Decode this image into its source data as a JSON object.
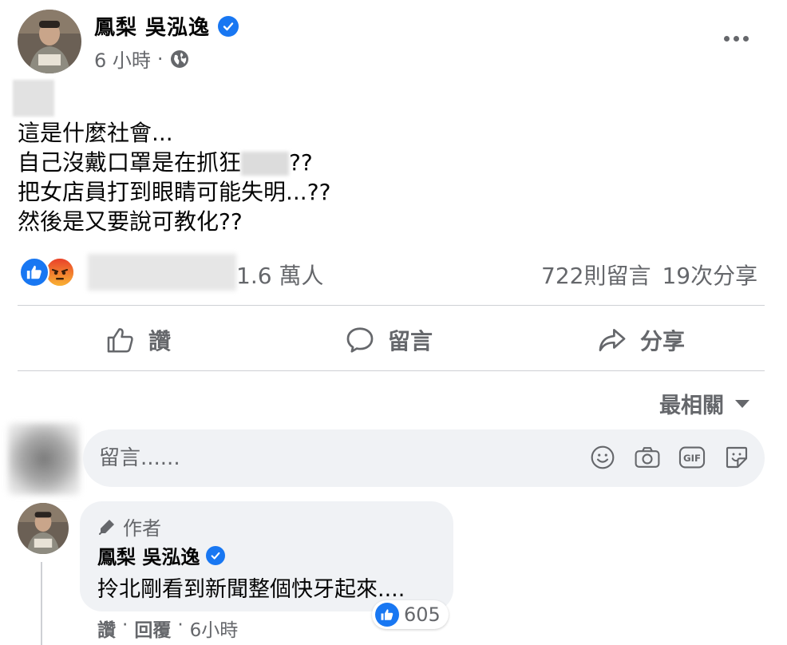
{
  "post": {
    "author": "鳳梨 吳泓逸",
    "time": "6 小時",
    "separator": "·",
    "lines": [
      {
        "text": "這是什麼社會..."
      },
      {
        "pre": "自己沒戴口罩是在抓狂",
        "post": "??"
      },
      {
        "text": "把女店員打到眼睛可能失明...??"
      },
      {
        "text": "然後是又要說可教化??"
      }
    ]
  },
  "reactions": {
    "count": "1.6 萬人",
    "comments": "722則留言",
    "shares": "19次分享"
  },
  "actions": {
    "like": "讚",
    "comment": "留言",
    "share": "分享"
  },
  "sort": {
    "label": "最相關"
  },
  "comment_input": {
    "placeholder": "留言......"
  },
  "reply": {
    "badge": "作者",
    "author": "鳳梨 吳泓逸",
    "text": "拎北剛看到新聞整個快牙起來....",
    "likes": "605",
    "like_label": "讚",
    "reply_label": "回覆",
    "separator": "·",
    "time": "6小時"
  },
  "colors": {
    "brand_blue": "#1877f2",
    "angry_orange": "#f4692a",
    "secondary_text": "#65676b",
    "bubble_bg": "#f0f2f5"
  },
  "icons": {
    "verified": "verified-check-icon",
    "globe": "globe-icon",
    "more": "more-horizontal-icon",
    "like_reaction": "thumbs-up-reaction-icon",
    "angry_reaction": "angry-face-reaction-icon",
    "like_action": "thumbs-up-outline-icon",
    "comment_action": "speech-bubble-icon",
    "share_action": "share-arrow-icon",
    "sort": "caret-down-icon",
    "emoji": "smiley-icon",
    "camera": "camera-icon",
    "gif": "gif-icon",
    "sticker": "sticker-icon",
    "author_badge": "pen-icon"
  }
}
